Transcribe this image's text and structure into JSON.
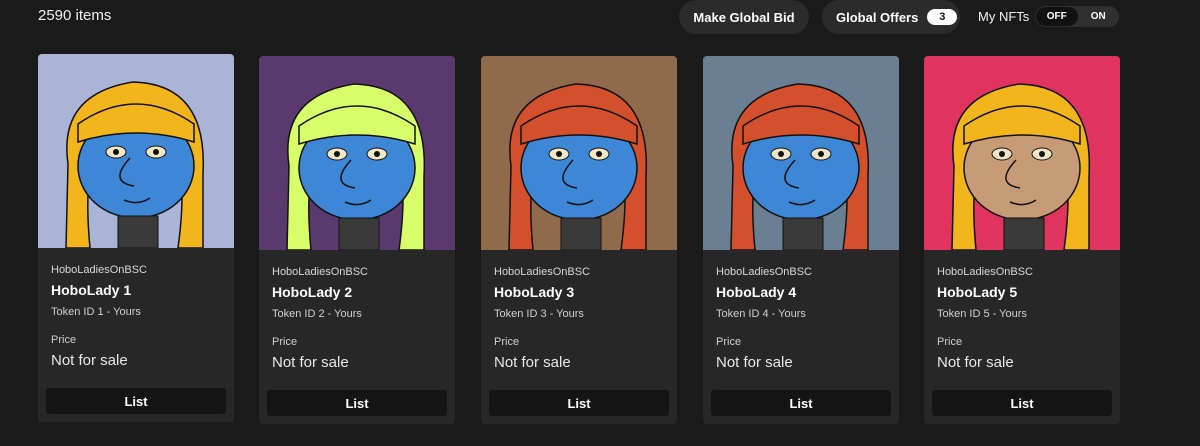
{
  "header": {
    "items_count": "2590 items",
    "make_global_bid": "Make Global Bid",
    "global_offers": "Global Offers",
    "global_offers_count": "3",
    "my_nfts_label": "My NFTs",
    "toggle_off": "OFF",
    "toggle_on": "ON"
  },
  "cards": [
    {
      "collection": "HoboLadiesOnBSC",
      "name": "HoboLady 1",
      "token": "Token ID 1 - Yours",
      "price_label": "Price",
      "price": "Not for sale",
      "button": "List",
      "bg": "#a9b4d6",
      "hair": "#f2b51c",
      "face": "#3e86d6"
    },
    {
      "collection": "HoboLadiesOnBSC",
      "name": "HoboLady 2",
      "token": "Token ID 2 - Yours",
      "price_label": "Price",
      "price": "Not for sale",
      "button": "List",
      "bg": "#5a3a6e",
      "hair": "#d8ff6a",
      "face": "#3e86d6"
    },
    {
      "collection": "HoboLadiesOnBSC",
      "name": "HoboLady 3",
      "token": "Token ID 3 - Yours",
      "price_label": "Price",
      "price": "Not for sale",
      "button": "List",
      "bg": "#8f6a4b",
      "hair": "#d4502c",
      "face": "#3e86d6"
    },
    {
      "collection": "HoboLadiesOnBSC",
      "name": "HoboLady 4",
      "token": "Token ID 4 - Yours",
      "price_label": "Price",
      "price": "Not for sale",
      "button": "List",
      "bg": "#6b7f93",
      "hair": "#d4502c",
      "face": "#3e86d6"
    },
    {
      "collection": "HoboLadiesOnBSC",
      "name": "HoboLady 5",
      "token": "Token ID 5 - Yours",
      "price_label": "Price",
      "price": "Not for sale",
      "button": "List",
      "bg": "#e0345e",
      "hair": "#f2b51c",
      "face": "#c79b76"
    }
  ]
}
